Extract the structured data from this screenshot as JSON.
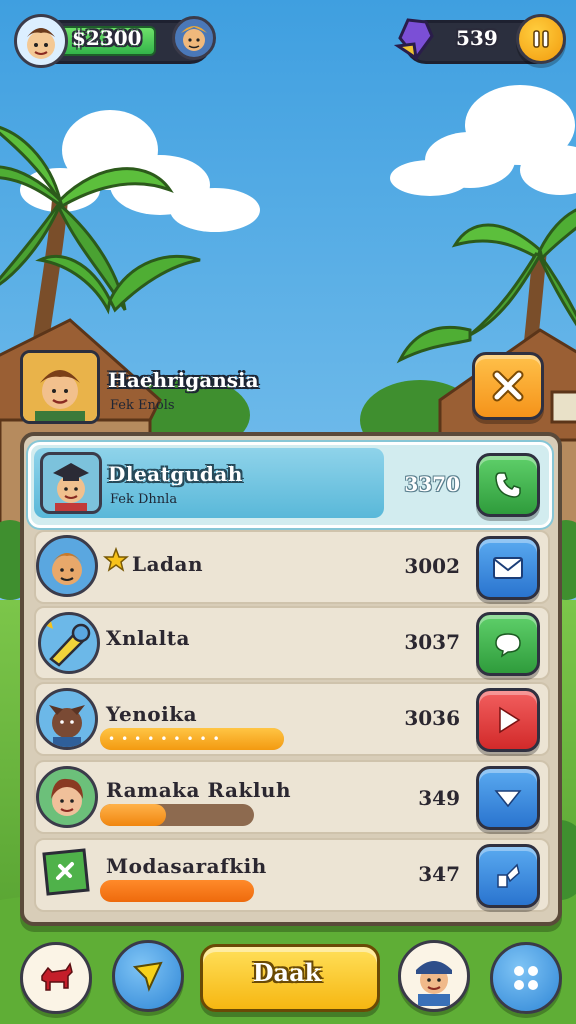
{
  "hud": {
    "money": "$2300",
    "gems": "539"
  },
  "profile": {
    "name": "Haehrigansia",
    "subtitle": "Fek Enols"
  },
  "leaderboard": [
    {
      "name": "Dleatgudah",
      "sub": "Fek Dhnla",
      "score": "3370",
      "action_icon": "phone-icon",
      "action_color": "#3fae4a"
    },
    {
      "name": "Ladan",
      "score": "3002",
      "action_icon": "mail-icon",
      "action_color": "#2f7fd9",
      "star": true
    },
    {
      "name": "Xnlalta",
      "score": "3037",
      "action_icon": "chat-bubble-icon",
      "action_color": "#3fae4a"
    },
    {
      "name": "Yenoika",
      "score": "3036",
      "action_icon": "play-icon",
      "action_color": "#e23b3b",
      "progress": 1.0
    },
    {
      "name": "Ramaka Rakluh",
      "score": "349",
      "action_icon": "chevron-down-icon",
      "action_color": "#2f7fd9",
      "progress": 0.43
    },
    {
      "name": "Modasarafkih",
      "score": "347",
      "action_icon": "share-icon",
      "action_color": "#2f7fd9",
      "progress": 1.0
    }
  ],
  "bottom": {
    "main_button": "Daak"
  }
}
